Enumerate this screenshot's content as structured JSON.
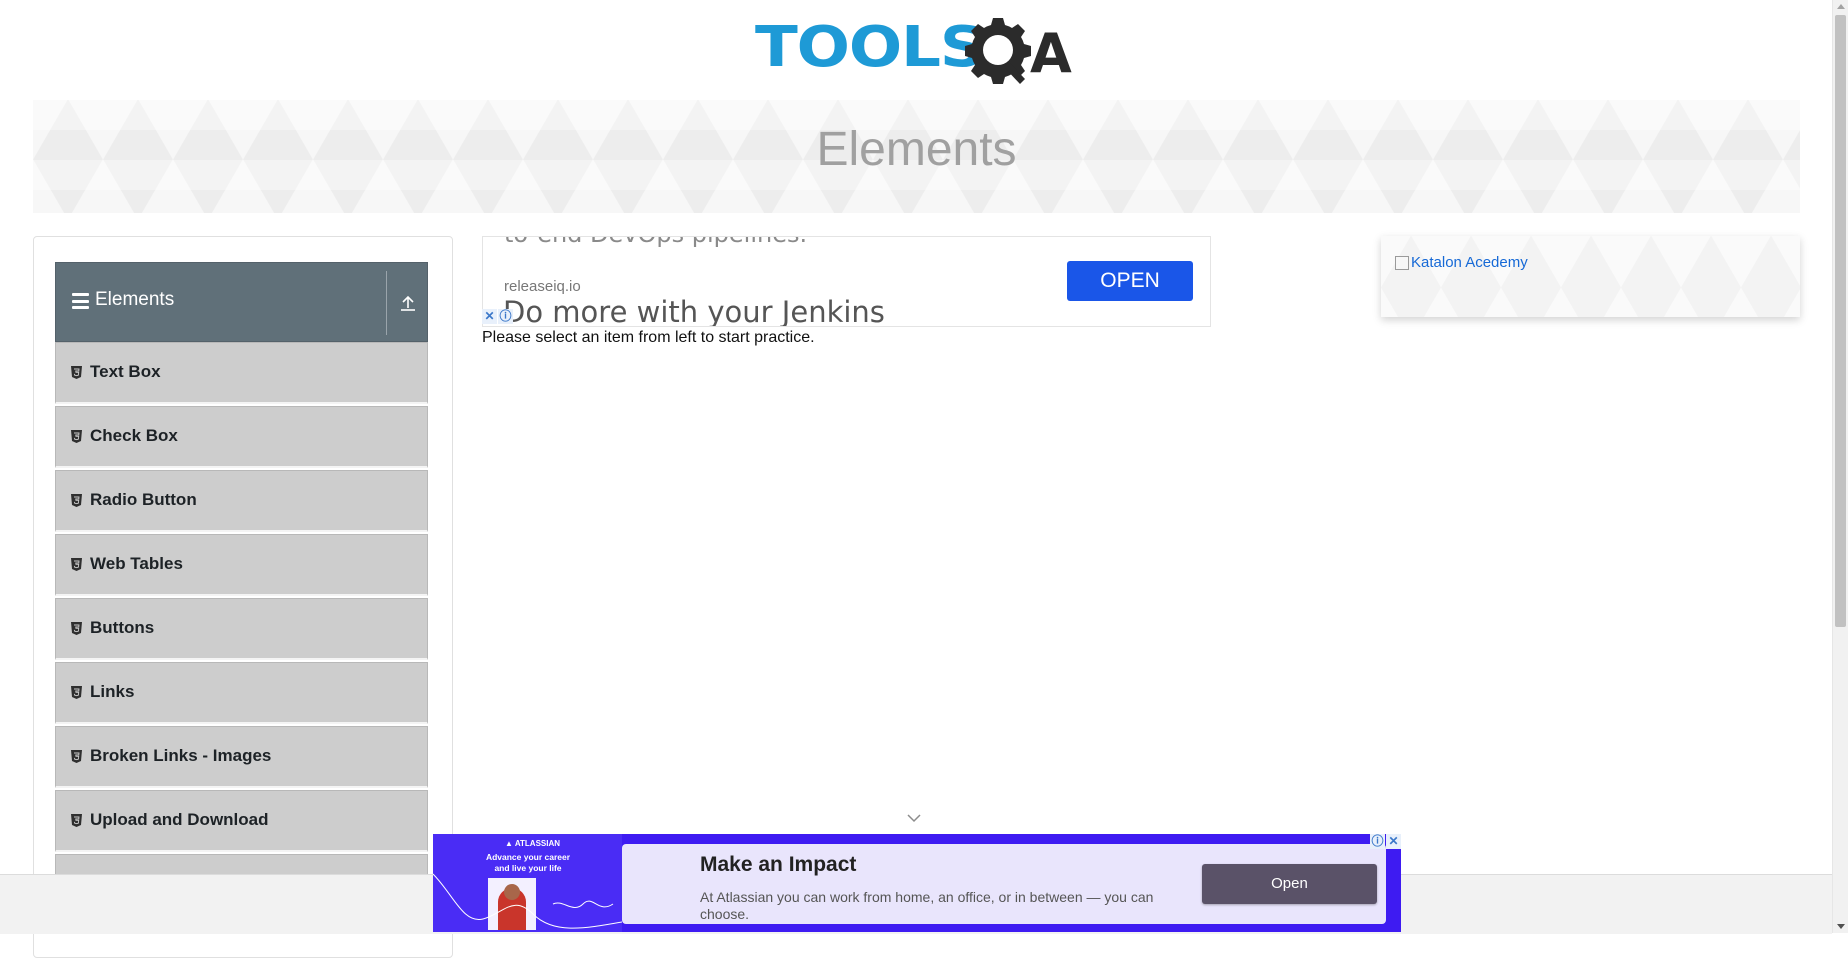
{
  "header": {
    "logo_text_tools": "TOOLS",
    "logo_text_a": "A",
    "logo_alt": "ToolsQA"
  },
  "banner": {
    "title": "Elements"
  },
  "sidebar": {
    "group_title": "Elements",
    "items": [
      {
        "label": "Text Box"
      },
      {
        "label": "Check Box"
      },
      {
        "label": "Radio Button"
      },
      {
        "label": "Web Tables"
      },
      {
        "label": "Buttons"
      },
      {
        "label": "Links"
      },
      {
        "label": "Broken Links - Images"
      },
      {
        "label": "Upload and Download"
      }
    ]
  },
  "ad_top": {
    "partial_text": "to-end DevOps pipelines.",
    "domain": "releaseiq.io",
    "button": "OPEN",
    "headline": "Do more with your Jenkins",
    "close_icon": "✕",
    "info_icon": "ⓘ"
  },
  "main": {
    "instruction": "Please select an item from left to start practice."
  },
  "side_ad": {
    "alt": "Katalon Acedemy"
  },
  "bottom_ad": {
    "brand": "▲ ATLASSIAN",
    "slogan": "Advance your career and live your life",
    "title": "Make an Impact",
    "description": "At Atlassian you can work from home, an office, or in between — you can choose.",
    "button": "Open",
    "info_icon": "ⓘ",
    "close_icon": "✕"
  },
  "colors": {
    "logo_blue": "#1e9ad6",
    "logo_dark": "#2b2b2b",
    "group_header_bg": "#607079",
    "menu_item_bg": "#cdcdcd",
    "ad_button_blue": "#1a56e8",
    "bottom_ad_purple": "#3e1bf2"
  }
}
